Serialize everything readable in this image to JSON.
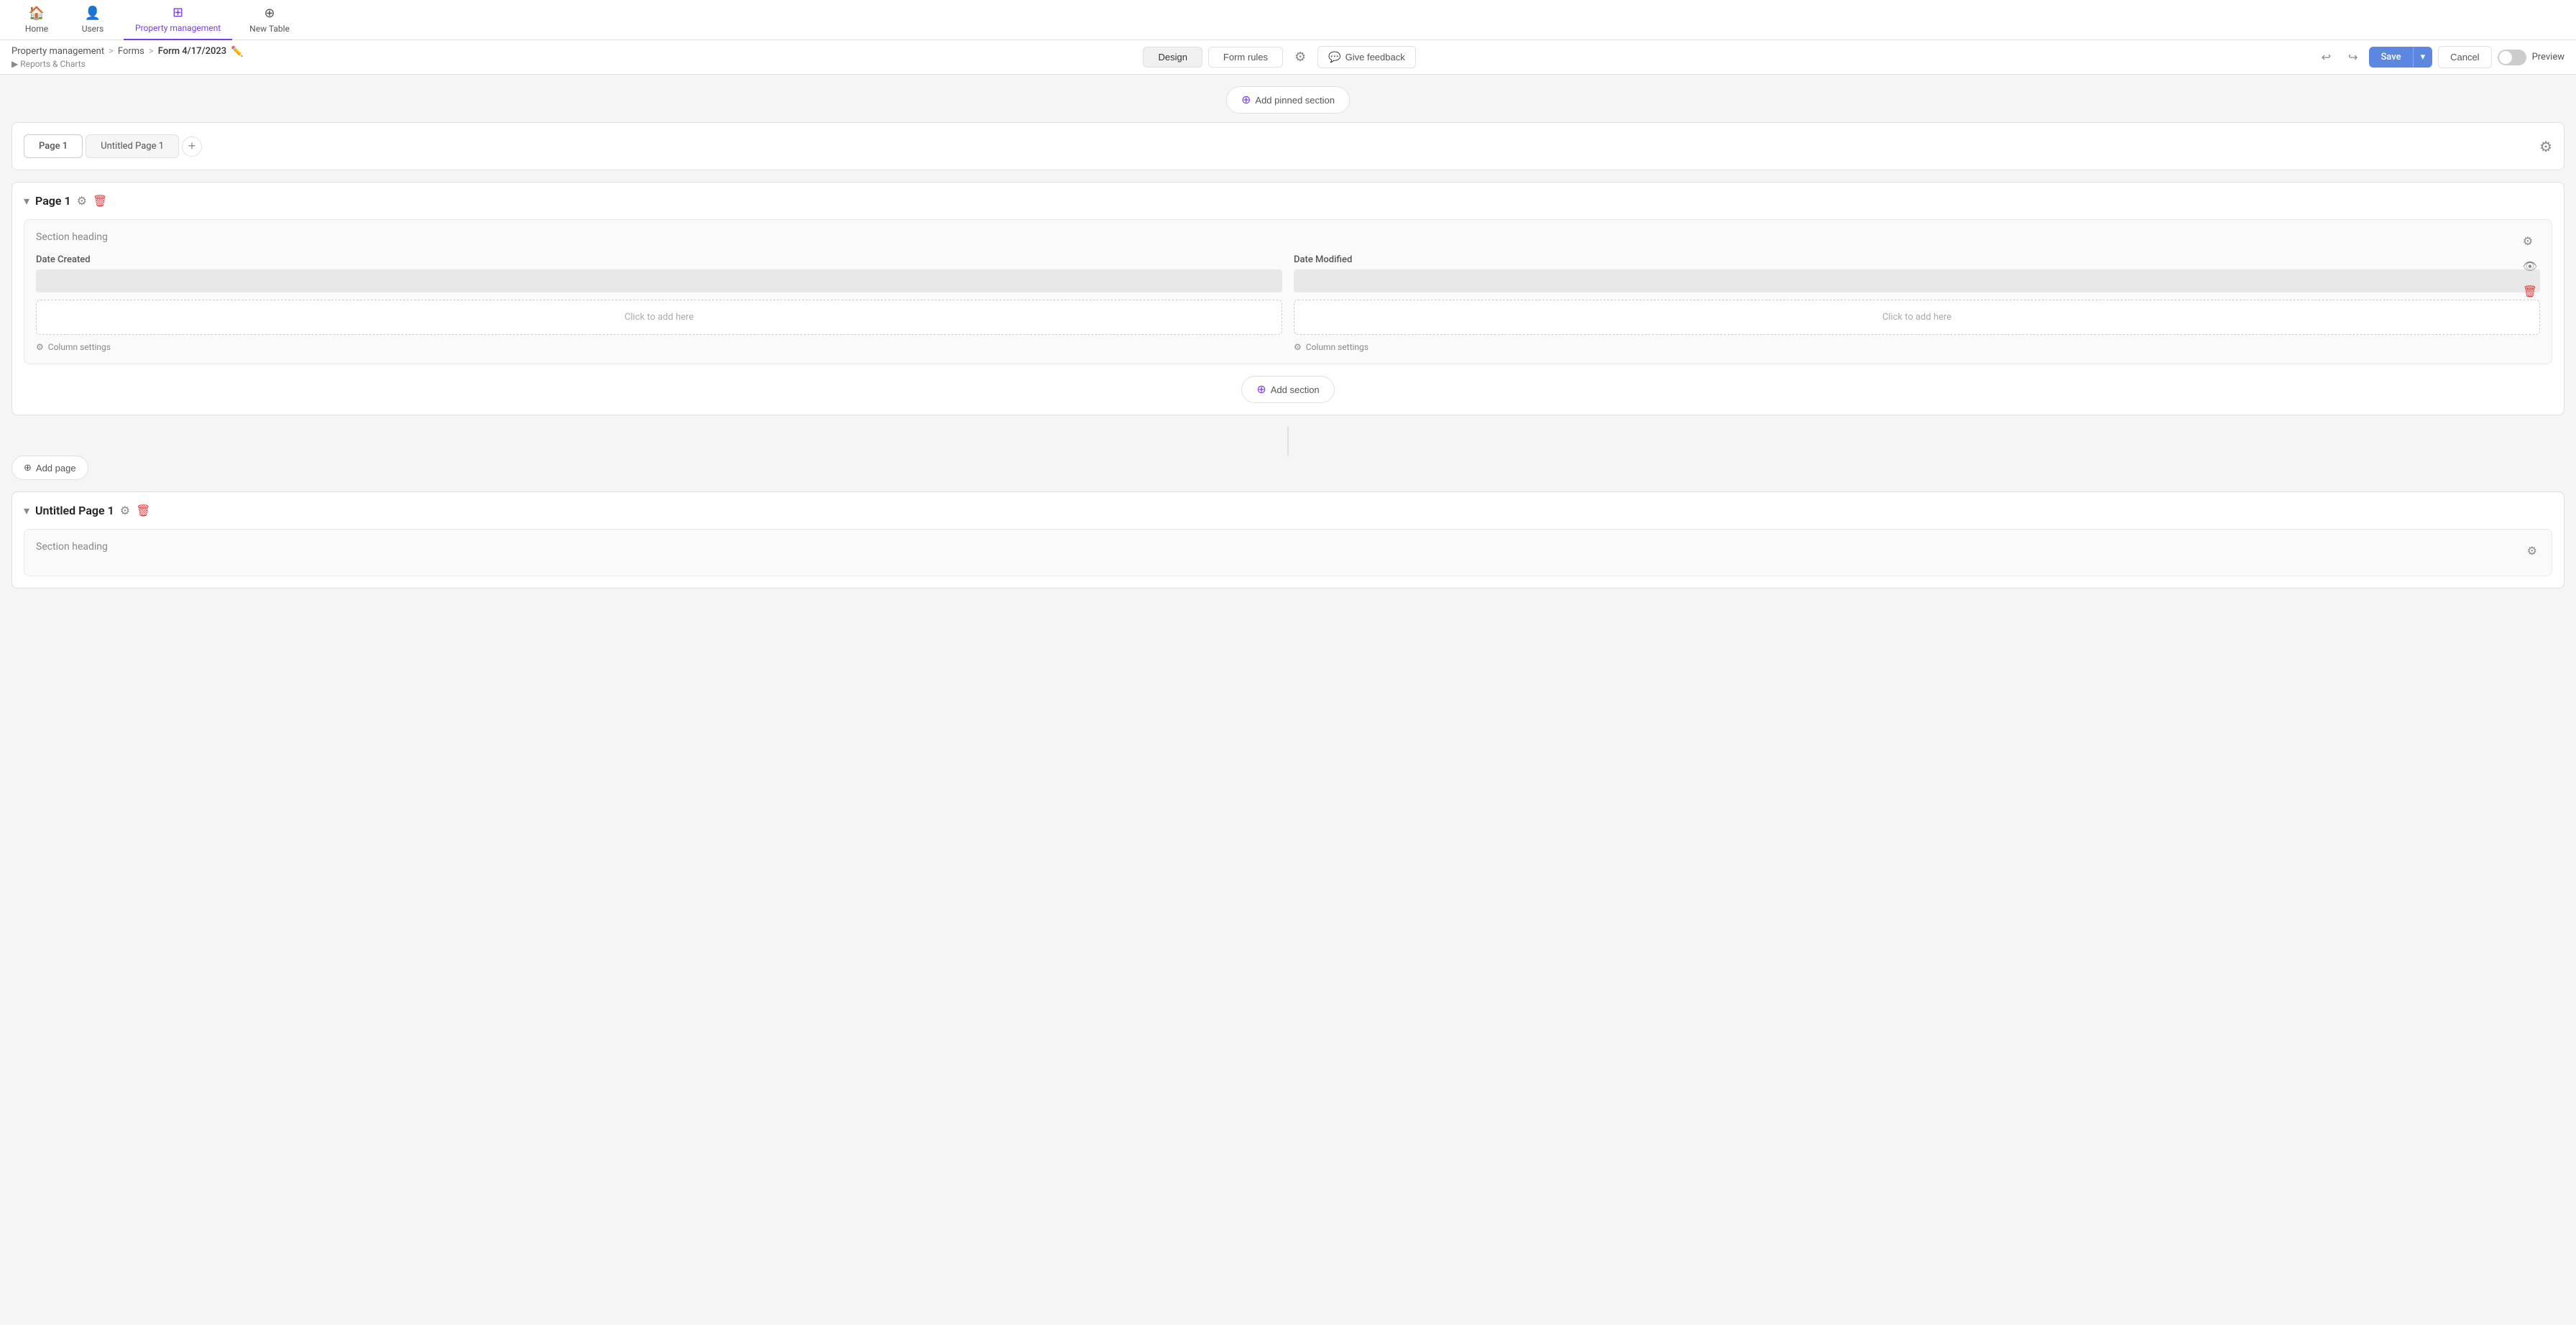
{
  "nav": {
    "home_label": "Home",
    "users_label": "Users",
    "property_management_label": "Property management",
    "new_table_label": "New Table"
  },
  "header": {
    "breadcrumb": {
      "root": "Property management",
      "sep1": ">",
      "forms": "Forms",
      "sep2": ">",
      "current": "Form 4/17/2023",
      "sub_reports": "▶ Reports & Charts"
    },
    "tabs": {
      "design": "Design",
      "form_rules": "Form rules"
    },
    "feedback_btn": "Give feedback",
    "save_btn": "Save",
    "cancel_btn": "Cancel",
    "preview_label": "Preview",
    "undo": "↩",
    "redo": "↪"
  },
  "add_pinned_section_label": "Add pinned section",
  "pages_tabs": {
    "tabs": [
      "Page 1",
      "Untitled Page 1"
    ],
    "add_tab_icon": "+"
  },
  "page1": {
    "title": "Page 1",
    "section_heading": "Section heading",
    "field_left": {
      "label": "Date Created",
      "click_to_add": "Click to add here",
      "column_settings": "Column settings"
    },
    "field_right": {
      "label": "Date Modified",
      "click_to_add": "Click to add here",
      "column_settings": "Column settings"
    },
    "add_section_label": "Add section"
  },
  "add_page_label": "Add page",
  "untitled_page": {
    "title": "Untitled Page 1",
    "section_heading": "Section heading"
  },
  "colors": {
    "accent": "#7c3aed",
    "save_blue": "#5b87e0",
    "danger_red": "#e53e3e",
    "feedback_blue": "#5b87e0"
  }
}
